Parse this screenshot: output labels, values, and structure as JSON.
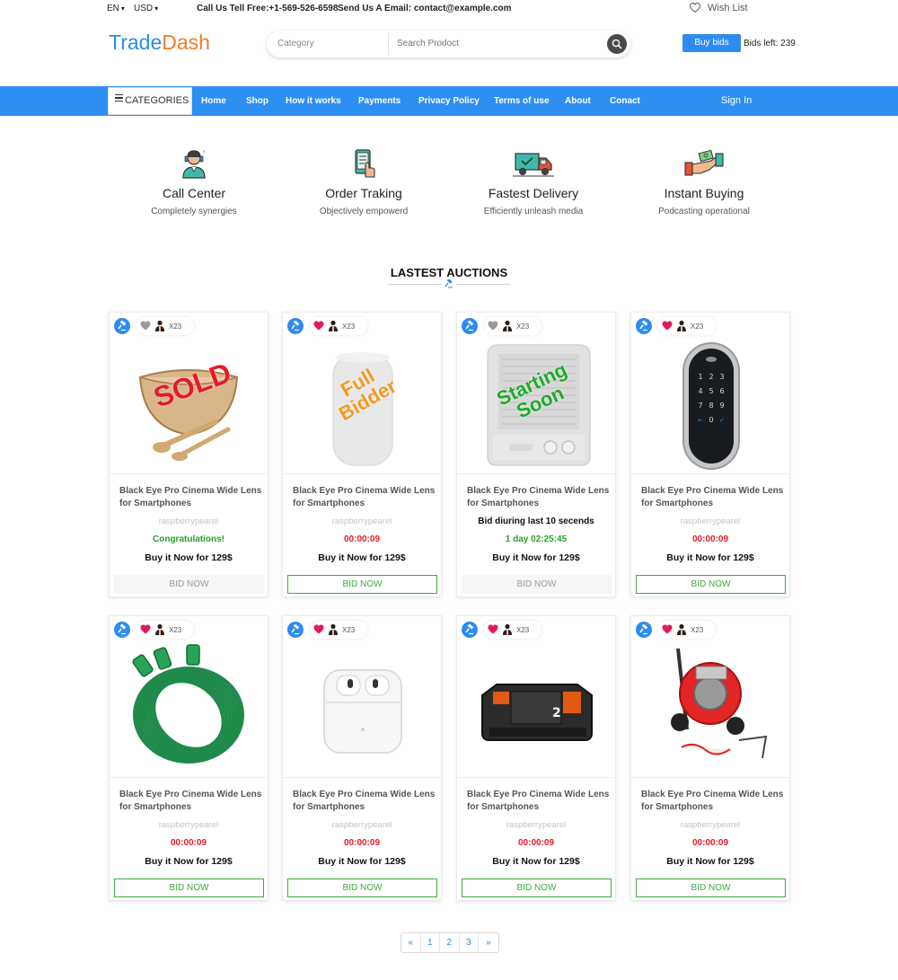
{
  "topbar": {
    "lang": "EN",
    "currency": "USD",
    "phone": "Call Us Tell Free:+1-569-526-6598",
    "email": "Send Us A Email: contact@example.com",
    "wishlist": "Wish List"
  },
  "header": {
    "logo_part1": "Trade",
    "logo_part2": "Dash",
    "search_category": "Category",
    "search_placeholder": "Search Prodoct",
    "buy_bids": "Buy bids",
    "bids_left": "Bids left: 239"
  },
  "nav": {
    "categories": "CATEGORIES",
    "items": [
      "Home",
      "Shop",
      "How it works",
      "Payments",
      "Privacy Policy",
      "Terms of use",
      "About",
      "Conact"
    ],
    "sign_in": "Sign In"
  },
  "features": [
    {
      "title": "Call Center",
      "subtitle": "Completely synergies",
      "icon": "headset-agent-icon"
    },
    {
      "title": "Order Traking",
      "subtitle": "Objectively empowerd",
      "icon": "phone-tracking-icon"
    },
    {
      "title": "Fastest Delivery",
      "subtitle": "Efficiently unleash media",
      "icon": "delivery-truck-icon"
    },
    {
      "title": "Instant Buying",
      "subtitle": "Podcasting operational",
      "icon": "handshake-money-icon"
    }
  ],
  "section_title": "LASTEST AUCTIONS",
  "colors": {
    "primary": "#2d8ff1",
    "logo_orange": "#f07b2d",
    "success": "#29a329",
    "danger": "#e41b2a"
  },
  "cards": [
    {
      "name": "Black Eye Pro Cinema Wide Lens for Smartphones",
      "seller": "raspberrypearel",
      "extra": "",
      "status": "Congratulations!",
      "status_color": "green",
      "price": "Buy it Now for 129$",
      "bid": "BID NOW",
      "bid_disabled": true,
      "liked": false,
      "count": "X23",
      "stamp": "SOLD",
      "product": "wooden-salad-bowl"
    },
    {
      "name": "Black Eye Pro Cinema Wide Lens for Smartphones",
      "seller": "raspberrypearel",
      "extra": "",
      "status": "00:00:09",
      "status_color": "red",
      "price": "Buy it Now for 129$",
      "bid": "BID NOW",
      "bid_disabled": false,
      "liked": true,
      "count": "X23",
      "stamp": "Full Bidder",
      "product": "smart-speaker"
    },
    {
      "name": "Black Eye Pro Cinema Wide Lens for Smartphones",
      "seller": "",
      "extra": "Bid diuring last 10 secends",
      "status": "1 day 02:25:45",
      "status_color": "green",
      "price": "Buy it Now for 129$",
      "bid": "BID NOW",
      "bid_disabled": true,
      "liked": false,
      "count": "X23",
      "stamp": "Starting Soon",
      "product": "space-heater"
    },
    {
      "name": "Black Eye Pro Cinema Wide Lens for Smartphones",
      "seller": "raspberrypearel",
      "extra": "",
      "status": "00:00:09",
      "status_color": "red",
      "price": "Buy it Now for 129$",
      "bid": "BID NOW",
      "bid_disabled": false,
      "liked": true,
      "count": "X23",
      "stamp": "",
      "product": "smart-lock"
    },
    {
      "name": "Black Eye Pro Cinema Wide Lens for Smartphones",
      "seller": "raspberrypearel",
      "extra": "",
      "status": "00:00:09",
      "status_color": "red",
      "price": "Buy it Now for 129$",
      "bid": "BID NOW",
      "bid_disabled": false,
      "liked": true,
      "count": "X23",
      "stamp": "",
      "product": "green-extension-cord"
    },
    {
      "name": "Black Eye Pro Cinema Wide Lens for Smartphones",
      "seller": "raspberrypearel",
      "extra": "",
      "status": "00:00:09",
      "status_color": "red",
      "price": "Buy it Now for 129$",
      "bid": "BID NOW",
      "bid_disabled": false,
      "liked": true,
      "count": "X23",
      "stamp": "",
      "product": "wireless-earbuds"
    },
    {
      "name": "Black Eye Pro Cinema Wide Lens for Smartphones",
      "seller": "raspberrypearel",
      "extra": "",
      "status": "00:00:09",
      "status_color": "red",
      "price": "Buy it Now for 129$",
      "bid": "BID NOW",
      "bid_disabled": false,
      "liked": true,
      "count": "X23",
      "stamp": "",
      "product": "power-tool-battery"
    },
    {
      "name": "Black Eye Pro Cinema Wide Lens for Smartphones",
      "seller": "raspberrypearel",
      "extra": "",
      "status": "00:00:09",
      "status_color": "red",
      "price": "Buy it Now for 129$",
      "bid": "BID NOW",
      "bid_disabled": false,
      "liked": true,
      "count": "X23",
      "stamp": "",
      "product": "drain-cleaning-machine"
    }
  ],
  "pagination": [
    "«",
    "1",
    "2",
    "3",
    "»"
  ]
}
